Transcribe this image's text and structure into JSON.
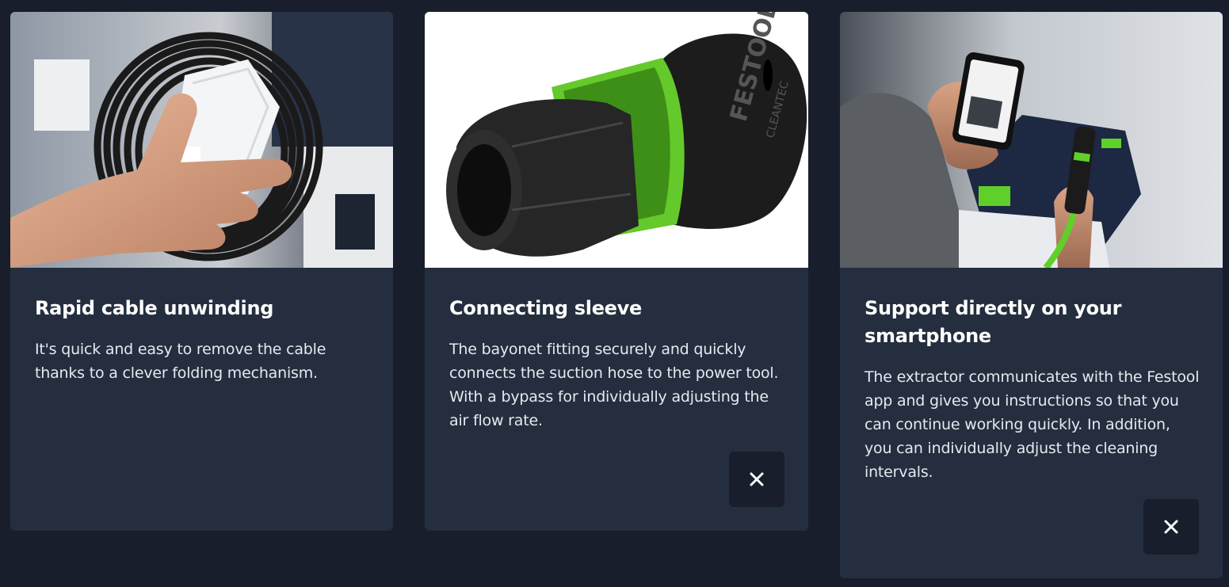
{
  "cards": [
    {
      "title": "Rapid cable unwinding",
      "description": "It's quick and easy to remove the cable thanks to a clever folding mechanism.",
      "image_icon": "cable-plug-photo"
    },
    {
      "title": "Connecting sleeve",
      "description": "The bayonet fitting securely and quickly connects the suction hose to the power tool. With a bypass for individually adjusting the air flow rate.",
      "image_icon": "connecting-sleeve-photo",
      "brand_text": "FESTOOL",
      "brand_subtext": "CLEANTEC",
      "close_icon": "close-icon"
    },
    {
      "title": "Support directly on your smartphone",
      "description": "The extractor communicates with the Festool app and gives you instructions so that you can continue working quickly. In addition, you can individually adjust the cleaning intervals.",
      "image_icon": "smartphone-extractor-photo",
      "close_icon": "close-icon"
    }
  ],
  "colors": {
    "page_background": "#181e2b",
    "card_background": "#242e3e",
    "accent_green": "#5fd02a",
    "text_primary": "#ffffff"
  }
}
